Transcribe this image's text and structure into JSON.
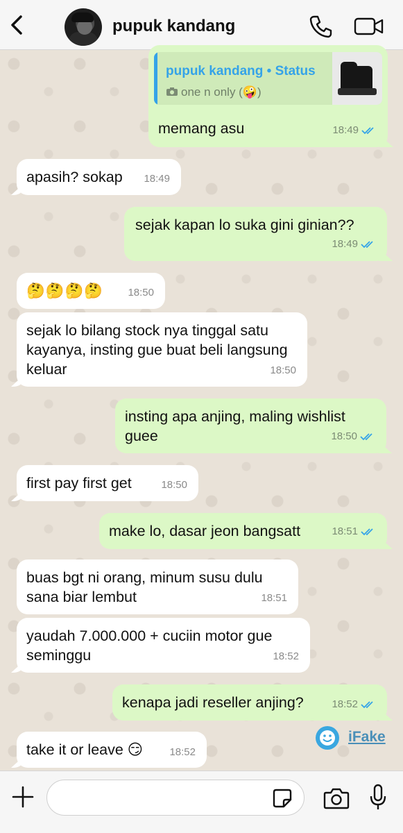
{
  "header": {
    "contact_name": "pupuk kandang",
    "icons": {
      "back": "chevron-left-icon",
      "call": "phone-icon",
      "video": "video-camera-icon"
    }
  },
  "quote": {
    "title": "pupuk kandang • Status",
    "subtitle": "one n only (🤪)"
  },
  "messages": [
    {
      "dir": "out",
      "text": "memang asu",
      "time": "18:49",
      "read": true
    },
    {
      "dir": "in",
      "text": "apasih? sokap",
      "time": "18:49"
    },
    {
      "dir": "out",
      "text": "sejak kapan lo suka gini ginian??",
      "time": "18:49",
      "read": true
    },
    {
      "dir": "in",
      "text": "🤔🤔🤔🤔",
      "time": "18:50"
    },
    {
      "dir": "in",
      "text": "sejak lo bilang stock nya tinggal satu kayanya, insting gue buat beli langsung keluar",
      "time": "18:50"
    },
    {
      "dir": "out",
      "text": "insting apa anjing, maling wishlist guee",
      "time": "18:50",
      "read": true
    },
    {
      "dir": "in",
      "text": "first pay first get",
      "time": "18:50"
    },
    {
      "dir": "out",
      "text": "make lo, dasar jeon bangsatt",
      "time": "18:51",
      "read": true
    },
    {
      "dir": "in",
      "text": "buas bgt ni orang, minum susu dulu sana biar lembut",
      "time": "18:51"
    },
    {
      "dir": "in",
      "text": "yaudah 7.000.000 + cuciin motor gue seminggu",
      "time": "18:52"
    },
    {
      "dir": "out",
      "text": "kenapa jadi reseller anjing?",
      "time": "18:52",
      "read": true
    },
    {
      "dir": "in",
      "text": "take it or leave 😏",
      "time": "18:52"
    }
  ],
  "watermark": {
    "label": "iFake"
  },
  "input": {
    "placeholder": "",
    "value": ""
  },
  "colors": {
    "outgoing": "#dcf8c6",
    "incoming": "#ffffff",
    "tick_read": "#35a3e8",
    "quote_accent": "#35a3e8"
  }
}
